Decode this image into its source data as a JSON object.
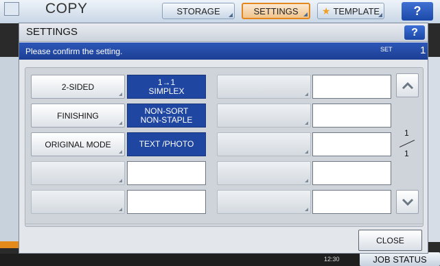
{
  "app": {
    "title": "COPY",
    "tabs": [
      {
        "label": "STORAGE"
      },
      {
        "label": "SETTINGS"
      },
      {
        "label": "TEMPLATE"
      }
    ],
    "help_label": "?",
    "job_status_label": "JOB STATUS",
    "clock": "12:30",
    "accent_color": "#e5861d"
  },
  "dialog": {
    "title": "SETTINGS",
    "help_label": "?",
    "message": "Please confirm the setting.",
    "set_label": "SET",
    "set_count": "1",
    "rows_left": [
      {
        "label": "2-SIDED",
        "value_line1": "1→1",
        "value_line2": "SIMPLEX"
      },
      {
        "label": "FINISHING",
        "value_line1": "NON-SORT",
        "value_line2": "NON-STAPLE"
      },
      {
        "label": "ORIGINAL MODE",
        "value_line1": "TEXT /PHOTO",
        "value_line2": ""
      },
      {
        "label": "",
        "value_line1": "",
        "value_line2": ""
      },
      {
        "label": "",
        "value_line1": "",
        "value_line2": ""
      }
    ],
    "page": {
      "current": "1",
      "total": "1"
    },
    "close_label": "CLOSE",
    "value_color": "#1f46a1"
  }
}
